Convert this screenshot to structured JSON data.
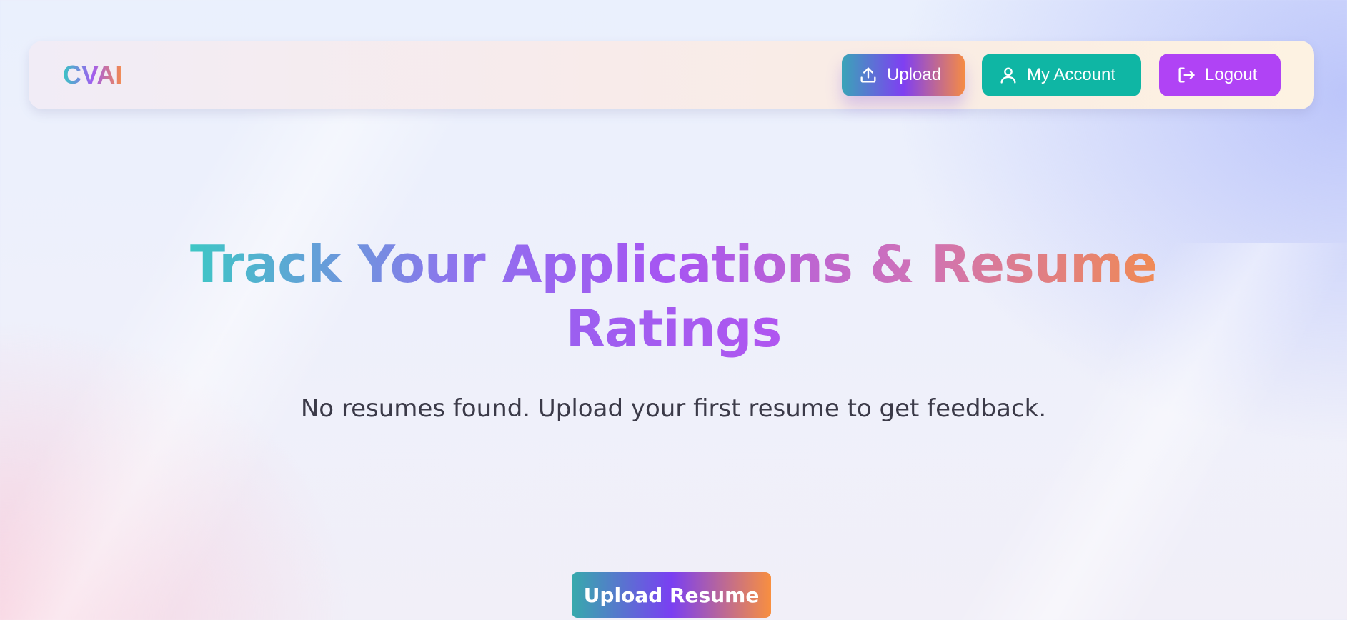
{
  "brand": {
    "logo_text": "CVAI"
  },
  "nav": {
    "upload": {
      "label": "Upload",
      "icon": "upload-icon"
    },
    "account": {
      "label": "My Account",
      "icon": "user-icon"
    },
    "logout": {
      "label": "Logout",
      "icon": "logout-icon"
    }
  },
  "hero": {
    "title_line1": "Track Your Applications & Resume",
    "title_line2": "Ratings",
    "subtitle": "No resumes found. Upload your first resume to get feedback.",
    "cta_label": "Upload Resume"
  },
  "colors": {
    "teal": "#0fb6a4",
    "purple": "#b043f5",
    "gradient_start": "#38c6c4",
    "gradient_mid": "#7f3ff2",
    "gradient_end": "#f58b45",
    "text_dark": "#3b3a48"
  }
}
